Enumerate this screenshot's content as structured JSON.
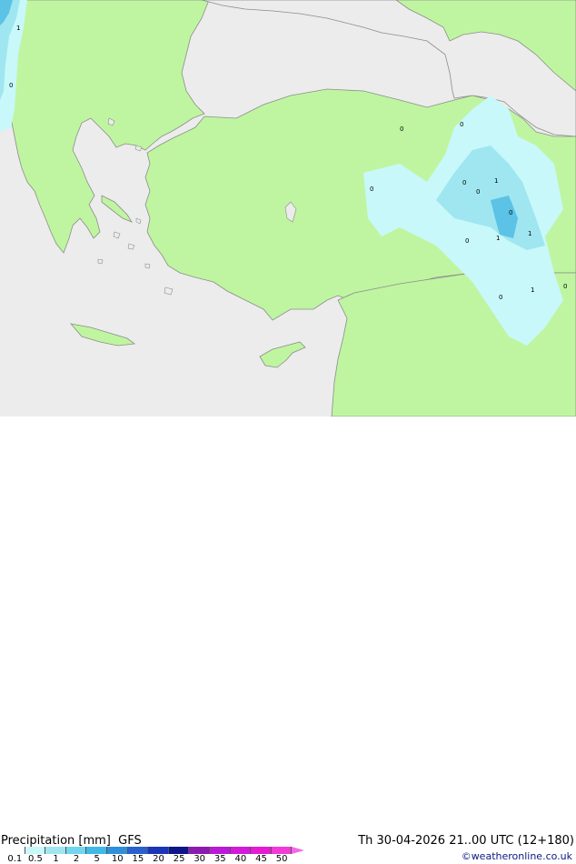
{
  "title": "Precipitation [mm]",
  "model": "GFS",
  "valid_time": "Th 30-04-2026 21..00 UTC (12+180)",
  "credit": "©weatheronline.co.uk",
  "colors": {
    "sea": "#ececec",
    "land": "#bff5a0",
    "coast": "#8c8c8c",
    "precip_light": "#c8f8fa",
    "precip_mid": "#9fe6f0",
    "precip_heavy": "#5cc2e6"
  },
  "legend": {
    "ticks": [
      "0.1",
      "0.5",
      "1",
      "2",
      "5",
      "10",
      "15",
      "20",
      "25",
      "30",
      "35",
      "40",
      "45",
      "50"
    ],
    "colors": [
      "#ffffff",
      "#c8f8fa",
      "#9fe6f0",
      "#72d6ee",
      "#40b9e6",
      "#2f8fda",
      "#2860d0",
      "#1c34b8",
      "#0c1688",
      "#8a1ab0",
      "#b81ad8",
      "#d21ad8",
      "#e61ad2",
      "#f23ad8"
    ],
    "arrow_color": "#f06ae6"
  },
  "point_values": [
    {
      "label": "1"
    },
    {
      "label": "0"
    },
    {
      "label": "0"
    },
    {
      "label": "0"
    },
    {
      "label": "0"
    },
    {
      "label": "0"
    },
    {
      "label": "1"
    },
    {
      "label": "0"
    },
    {
      "label": "1"
    },
    {
      "label": "0"
    },
    {
      "label": "1"
    },
    {
      "label": "1"
    },
    {
      "label": "0"
    },
    {
      "label": "0"
    },
    {
      "label": "0"
    }
  ]
}
